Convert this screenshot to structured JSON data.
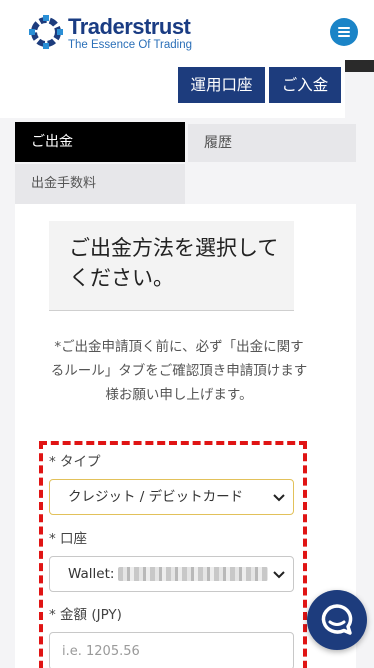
{
  "brand": {
    "name": "Traderstrust",
    "tagline": "The Essence Of Trading",
    "colors": {
      "navy": "#1d3c7d",
      "accent_blue": "#1b84c7",
      "highlight_red": "#e01414"
    }
  },
  "header": {
    "menu_icon": "hamburger-icon"
  },
  "actions": {
    "account_label": "運用口座",
    "deposit_label": "ご入金"
  },
  "tabs": [
    {
      "label": "ご出金",
      "active": true
    },
    {
      "label": "履歴",
      "active": false
    },
    {
      "label": "出金手数料",
      "active": false
    }
  ],
  "main": {
    "title": "ご出金方法を選択してください。",
    "notice": "*ご出金申請頂く前に、必ず「出金に関するルール」タブをご確認頂き申請頂けます様お願い申し上げます。"
  },
  "form": {
    "type_label": "タイプ",
    "type_value": "クレジット / デビットカード",
    "account_label": "口座",
    "account_value": "Wallet:",
    "amount_label": "金額 (JPY)",
    "amount_placeholder": "i.e. 1205.56",
    "required_mark": "*"
  },
  "chat": {
    "icon": "chat-icon"
  }
}
